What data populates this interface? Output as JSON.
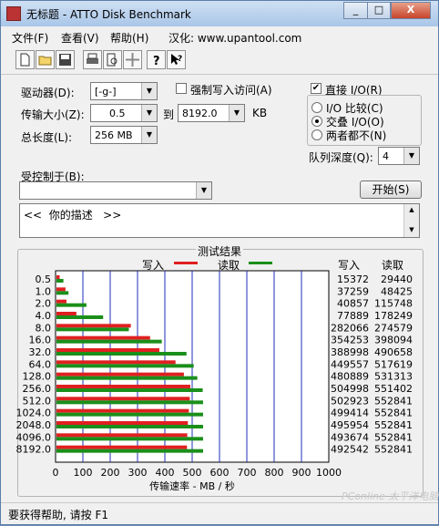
{
  "window": {
    "title": "无标题 - ATTO Disk Benchmark",
    "controls": [
      "_",
      "□",
      "X"
    ]
  },
  "menu": [
    {
      "label": "文件(F)"
    },
    {
      "label": "查看(V)"
    },
    {
      "label": "帮助(H)"
    },
    {
      "label": "汉化: www.upantool.com"
    }
  ],
  "toolbar": {
    "icons": [
      "new-document-icon",
      "open-folder-icon",
      "save-icon",
      "print-icon",
      "print-preview-icon",
      "move-icon",
      "help-icon",
      "context-help-icon"
    ]
  },
  "settings": {
    "drive_label": "驱动器(D):",
    "drive_value": "[-g-]",
    "force_write_label": "强制写入访问(A)",
    "force_write_checked": false,
    "transfer_size_label": "传输大小(Z):",
    "transfer_from": "0.5",
    "to_label": "到",
    "transfer_to": "8192.0",
    "kb_label": "KB",
    "total_length_label": "总长度(L):",
    "total_length_value": "256 MB",
    "controlled_by_label": "受控制于(B):",
    "controlled_by_value": ""
  },
  "io": {
    "direct_io_label": "直接 I/O(R)",
    "direct_io_checked": true,
    "options": [
      {
        "label": "I/O 比较(C)",
        "selected": false
      },
      {
        "label": "交叠 I/O(O)",
        "selected": true
      },
      {
        "label": "两者都不(N)",
        "selected": false
      }
    ],
    "queue_depth_label": "队列深度(Q):",
    "queue_depth_value": "4",
    "start_button": "开始(S)"
  },
  "description": "<<  你的描述   >>",
  "results": {
    "group_title": "测试结果",
    "legend_write": "写入",
    "legend_read": "读取",
    "col_write": "写入",
    "col_read": "读取"
  },
  "chart_data": {
    "type": "bar",
    "orientation": "horizontal",
    "categories": [
      "0.5",
      "1.0",
      "2.0",
      "4.0",
      "8.0",
      "16.0",
      "32.0",
      "64.0",
      "128.0",
      "256.0",
      "512.0",
      "1024.0",
      "2048.0",
      "4096.0",
      "8192.0"
    ],
    "series": [
      {
        "name": "写入",
        "color": "#e02020",
        "values": [
          15372,
          37259,
          40857,
          77889,
          282066,
          354253,
          388998,
          449557,
          480889,
          504998,
          502923,
          499414,
          495954,
          493674,
          492542
        ]
      },
      {
        "name": "读取",
        "color": "#1a8f1a",
        "values": [
          29440,
          48425,
          115748,
          178249,
          274579,
          398094,
          490658,
          517619,
          531313,
          551402,
          552841,
          552841,
          552841,
          552841,
          552841
        ]
      }
    ],
    "xlim": [
      0,
      1000
    ],
    "xticks": [
      0,
      100,
      200,
      300,
      400,
      500,
      600,
      700,
      800,
      900,
      1000
    ],
    "xlabel": "传输速率 - MB / 秒",
    "grid": true
  },
  "watermark": "PConline 太平洋电脑网",
  "status": "要获得帮助, 请按 F1"
}
